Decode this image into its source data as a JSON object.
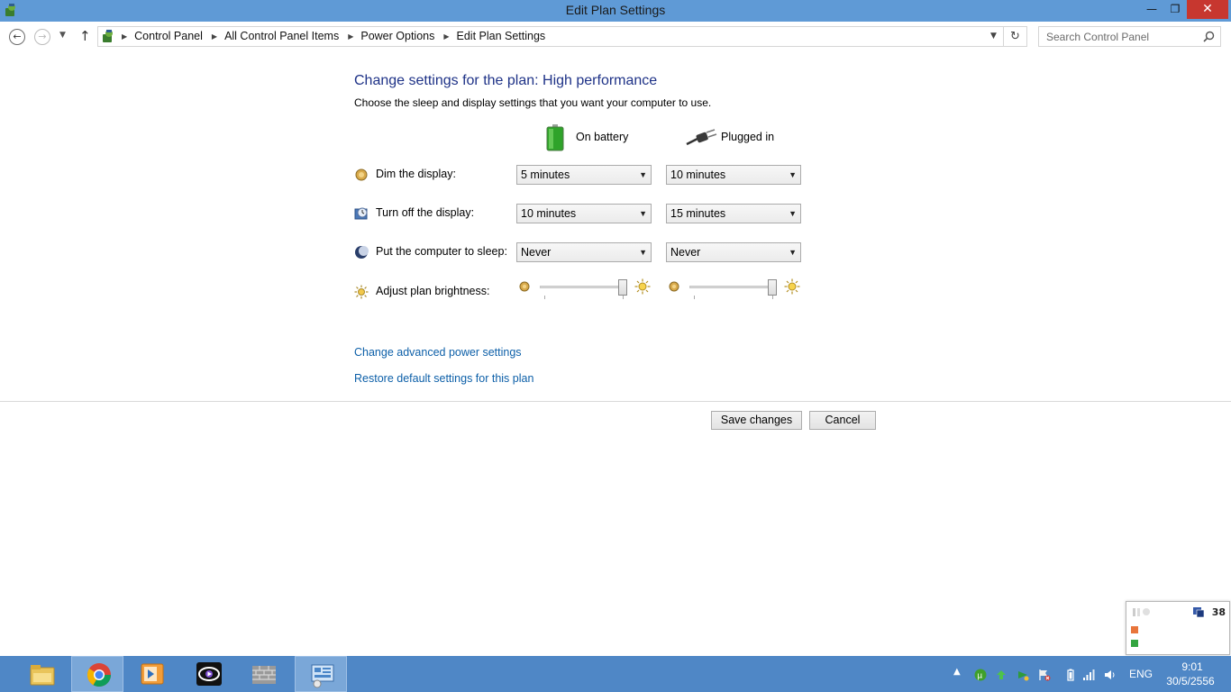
{
  "window": {
    "title": "Edit Plan Settings",
    "minimize_glyph": "—",
    "maximize_glyph": "❐",
    "close_glyph": "✕"
  },
  "navigation": {
    "breadcrumbs": [
      "Control Panel",
      "All Control Panel Items",
      "Power Options",
      "Edit Plan Settings"
    ],
    "search_placeholder": "Search Control Panel"
  },
  "plan": {
    "heading": "Change settings for the plan: High performance",
    "description": "Choose the sleep and display settings that you want your computer to use.",
    "columns": {
      "battery": "On battery",
      "plugged": "Plugged in"
    },
    "settings": [
      {
        "label": "Dim the display:",
        "battery": "5 minutes",
        "plugged": "10 minutes",
        "icon": "dim-display-icon"
      },
      {
        "label": "Turn off the display:",
        "battery": "10 minutes",
        "plugged": "15 minutes",
        "icon": "display-off-icon"
      },
      {
        "label": "Put the computer to sleep:",
        "battery": "Never",
        "plugged": "Never",
        "icon": "sleep-icon"
      }
    ],
    "brightness": {
      "label": "Adjust plan brightness:",
      "battery_level": 1.0,
      "plugged_level": 1.0
    }
  },
  "links": {
    "advanced": "Change advanced power settings",
    "restore": "Restore default settings for this plan"
  },
  "buttons": {
    "save": "Save changes",
    "cancel": "Cancel"
  },
  "taskbar": {
    "pinned": [
      "file-explorer-icon",
      "chrome-icon",
      "media-player-icon",
      "video-app-icon",
      "firewall-app-icon",
      "control-panel-icon"
    ],
    "active": "control-panel-icon",
    "language": "ENG",
    "time": "9:01",
    "date": "30/5/2556",
    "tray_badge": "38"
  },
  "colors": {
    "title_bar": "#5f9ad6",
    "close_button": "#c7372f",
    "heading": "#1e3287",
    "link": "#0c5fa8",
    "taskbar": "#4f87c6"
  }
}
